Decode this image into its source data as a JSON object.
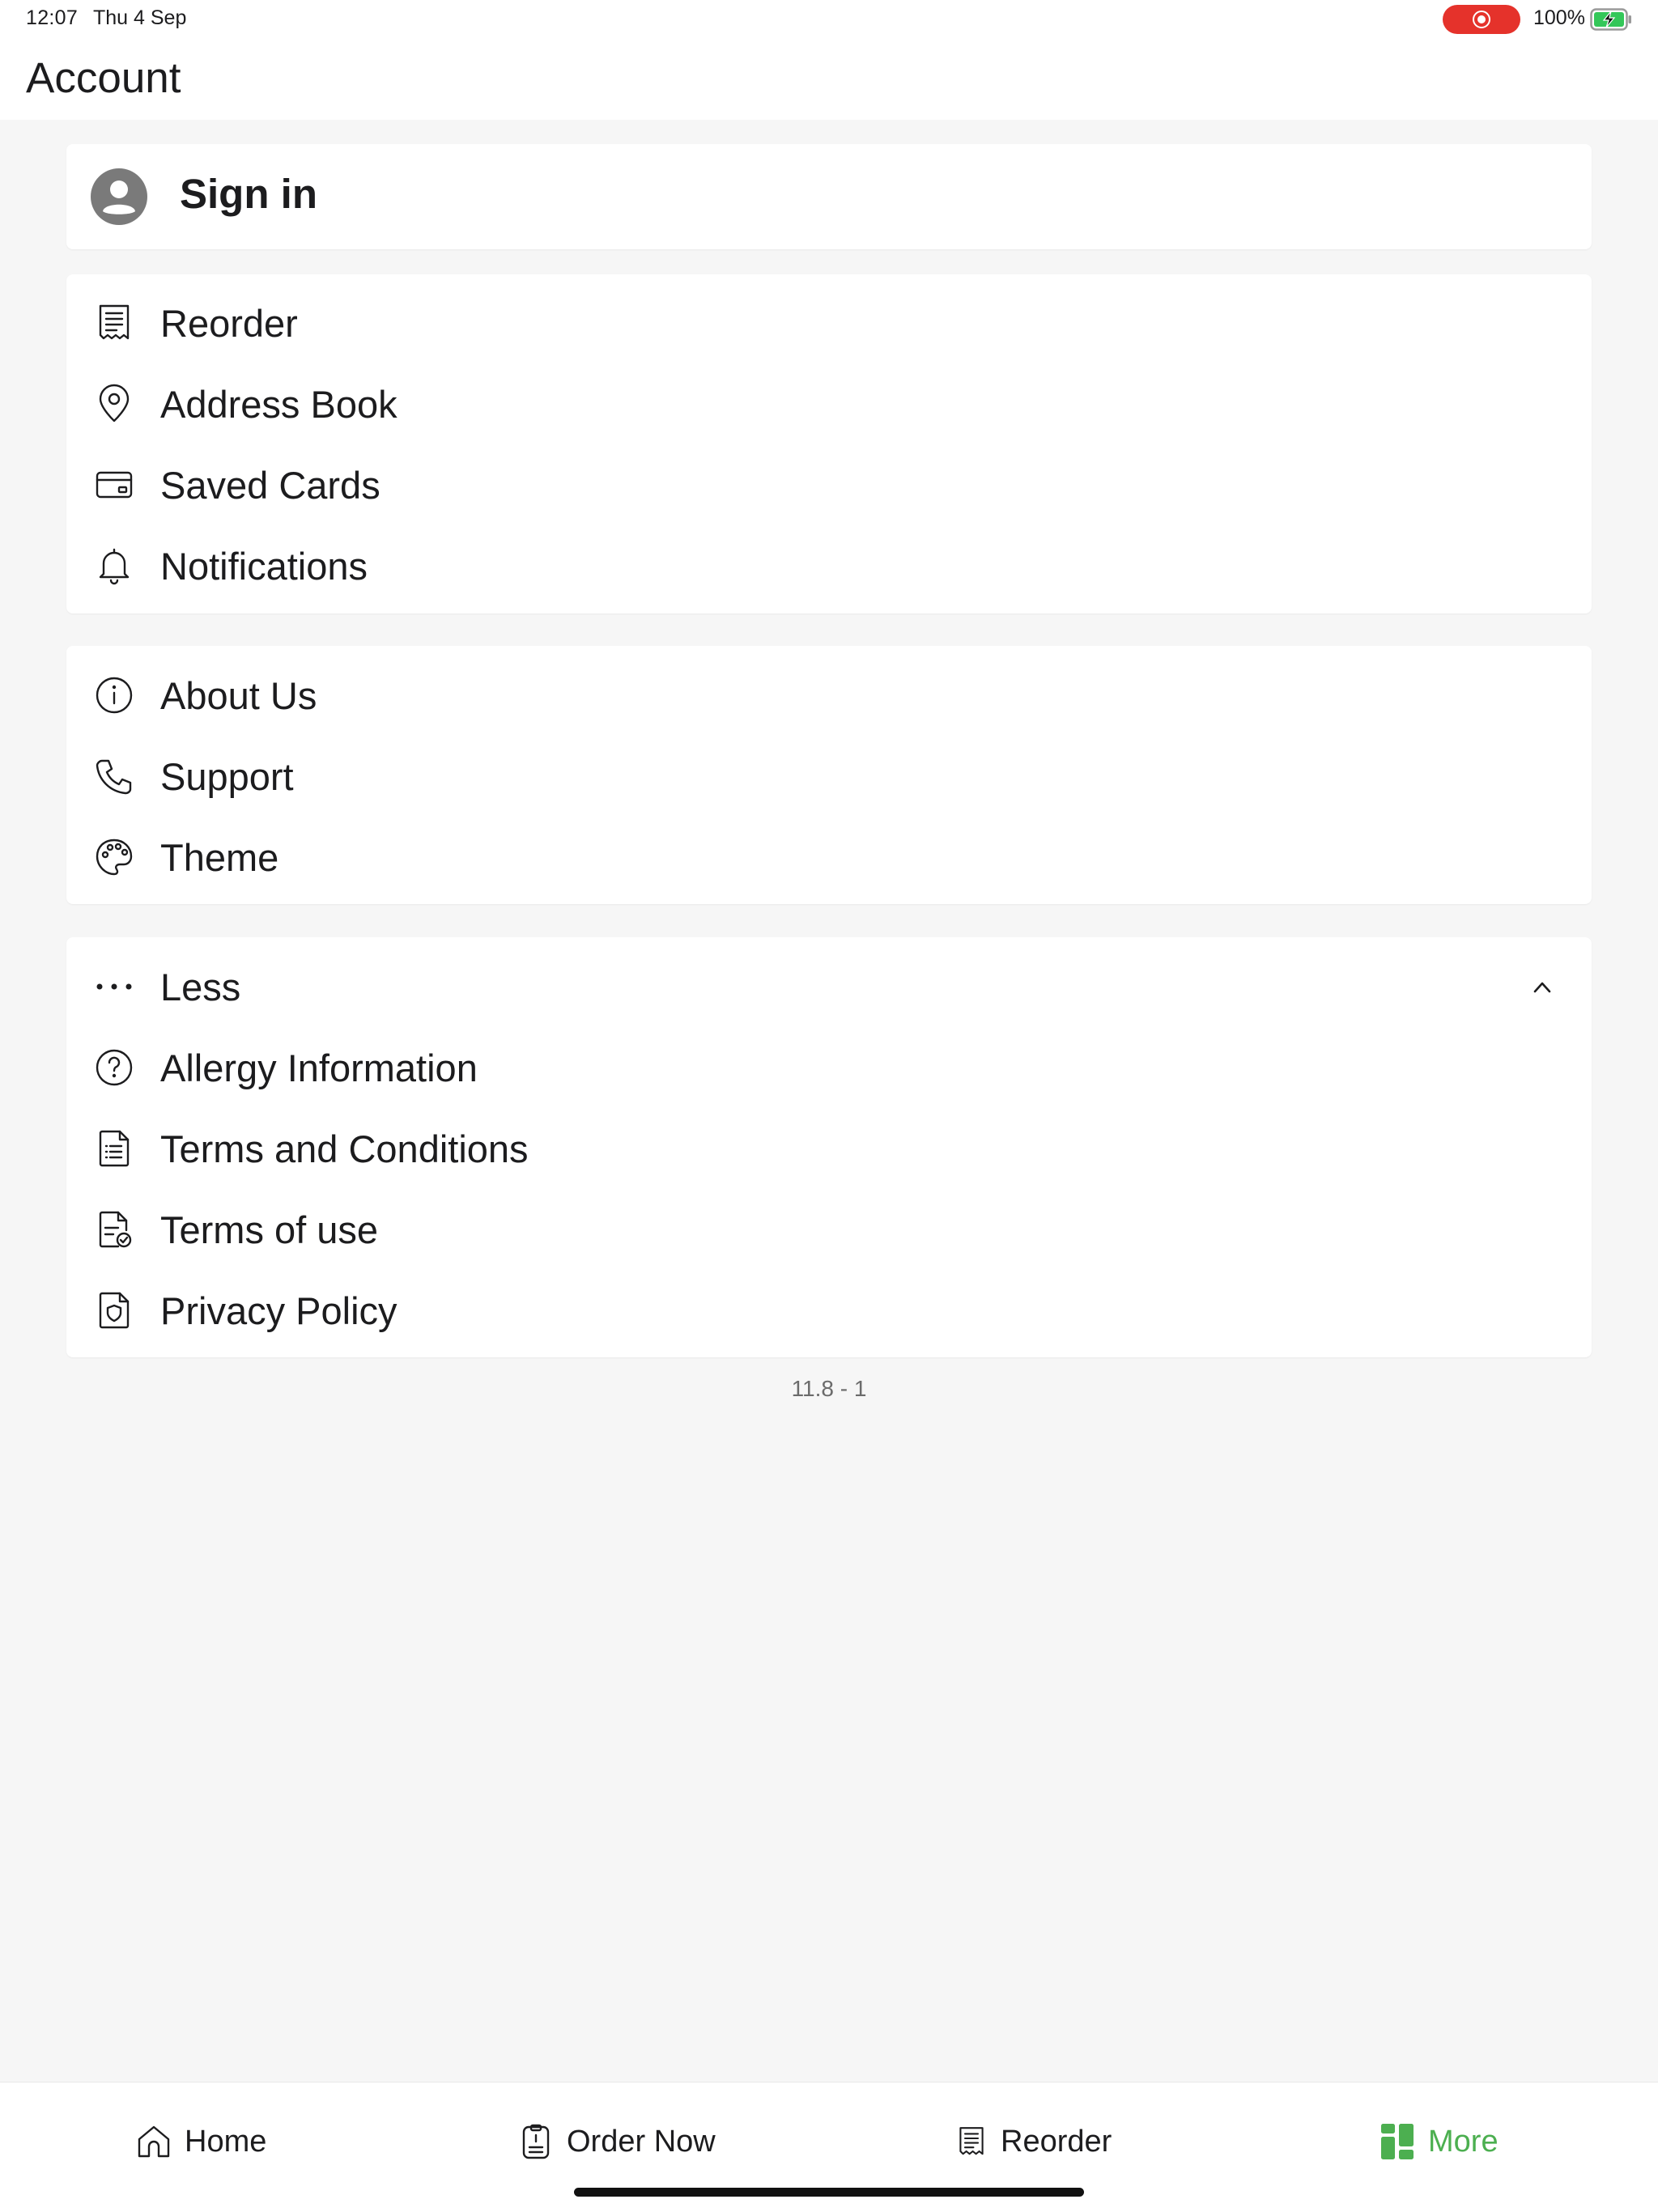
{
  "status_bar": {
    "time": "12:07",
    "date": "Thu 4 Sep",
    "battery": "100%",
    "record_color": "#e5322b",
    "battery_color": "#34c759"
  },
  "header": {
    "title": "Account"
  },
  "sign_in": {
    "label": "Sign in",
    "icon": "user-avatar-icon"
  },
  "account_items": [
    {
      "label": "Reorder",
      "icon": "receipt-icon"
    },
    {
      "label": "Address Book",
      "icon": "location-pin-icon"
    },
    {
      "label": "Saved Cards",
      "icon": "credit-card-icon"
    },
    {
      "label": "Notifications",
      "icon": "bell-icon"
    }
  ],
  "info_items": [
    {
      "label": "About Us",
      "icon": "info-icon"
    },
    {
      "label": "Support",
      "icon": "phone-icon"
    },
    {
      "label": "Theme",
      "icon": "palette-icon"
    }
  ],
  "more_section": {
    "toggle_label": "Less",
    "toggle_icon": "ellipsis-icon",
    "expanded": true,
    "items": [
      {
        "label": "Allergy Information",
        "icon": "question-circle-icon"
      },
      {
        "label": "Terms and Conditions",
        "icon": "document-list-icon"
      },
      {
        "label": "Terms of use",
        "icon": "document-check-icon"
      },
      {
        "label": "Privacy Policy",
        "icon": "shield-document-icon"
      }
    ]
  },
  "version": "11.8 - 1",
  "tab_bar": {
    "active_color": "#4caf50",
    "tabs": [
      {
        "label": "Home",
        "icon": "home-icon",
        "active": false
      },
      {
        "label": "Order Now",
        "icon": "order-icon",
        "active": false
      },
      {
        "label": "Reorder",
        "icon": "receipt-icon",
        "active": false
      },
      {
        "label": "More",
        "icon": "grid-icon",
        "active": true
      }
    ]
  }
}
